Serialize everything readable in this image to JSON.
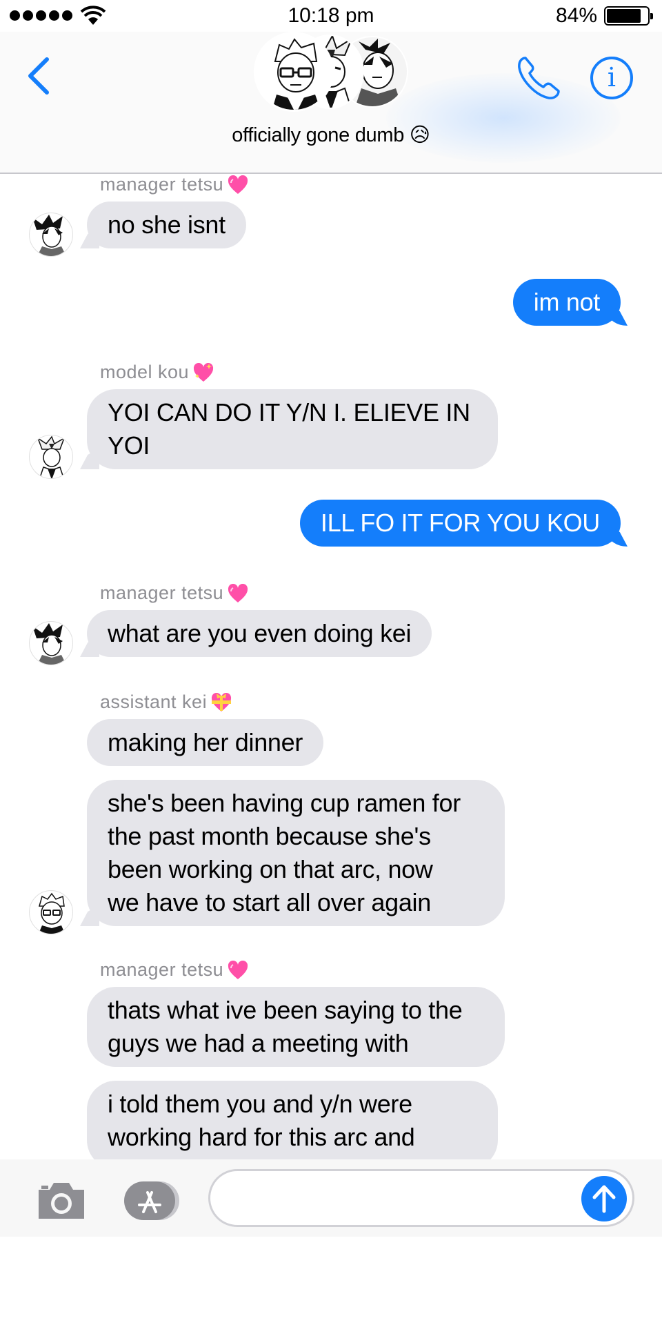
{
  "status_bar": {
    "time": "10:18 pm",
    "battery_percent": "84%",
    "battery_level": 0.84
  },
  "header": {
    "group_name": "officially gone dumb 😥",
    "back_icon": "chevron-left-icon",
    "call_icon": "phone-icon",
    "info_icon": "info-icon",
    "info_glyph": "i"
  },
  "messages": [
    {
      "sender": "manager tetsu",
      "sender_emoji": "pink-heart",
      "text": "no she isnt",
      "direction": "incoming"
    },
    {
      "text": "im not",
      "direction": "outgoing"
    },
    {
      "sender": "model kou",
      "sender_emoji": "sparkling-heart",
      "text": "YOI CAN DO IT Y/N I. ELIEVE IN\nYOI",
      "direction": "incoming"
    },
    {
      "text": "ILL FO IT FOR YOU KOU",
      "direction": "outgoing"
    },
    {
      "sender": "manager tetsu",
      "sender_emoji": "pink-heart",
      "text": "what are you even doing kei",
      "direction": "incoming"
    },
    {
      "sender": "assistant kei",
      "sender_emoji": "heart-with-ribbon",
      "text": "making her dinner",
      "direction": "incoming"
    },
    {
      "text": "she's been having cup ramen for\nthe past month because she's\nbeen working on that arc, now\nwe have to start all over again",
      "direction": "incoming"
    },
    {
      "sender": "manager tetsu",
      "sender_emoji": "pink-heart",
      "text": "thats what ive been saying to the\nguys we had a meeting with",
      "direction": "incoming"
    },
    {
      "text": "i told them you and y/n were\nworking hard for this arc and",
      "direction": "incoming"
    }
  ],
  "compose": {
    "camera_icon": "camera-icon",
    "apps_icon": "app-store-icon",
    "send_icon": "send-arrow-icon",
    "input_value": "",
    "input_placeholder": ""
  },
  "colors": {
    "accent": "#147efb",
    "incoming_bubble": "#e5e5ea",
    "sender_label": "#8e8e93"
  }
}
